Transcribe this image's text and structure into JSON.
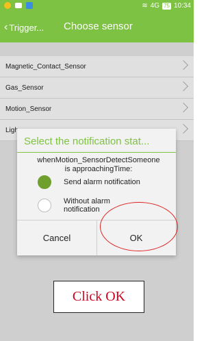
{
  "status_bar": {
    "carrier_icons": [
      "app-icon",
      "message-icon",
      "ie-icon"
    ],
    "signal_text": "4G",
    "battery": "75",
    "time": "10:34"
  },
  "app_bar": {
    "back_label": "Trigger...",
    "title": "Choose sensor",
    "color": "#7dc242"
  },
  "sensor_list": [
    {
      "label": "Magnetic_Contact_Sensor"
    },
    {
      "label": "Gas_Sensor"
    },
    {
      "label": "Motion_Sensor"
    },
    {
      "label": "Ligh"
    }
  ],
  "dialog": {
    "title": "Select the notification stat...",
    "message": "whenMotion_SensorDetectSomeone is approachingTime:",
    "options": [
      {
        "label": "Send alarm notification",
        "selected": true
      },
      {
        "label": "Without alarm notification",
        "selected": false
      }
    ],
    "cancel_label": "Cancel",
    "ok_label": "OK"
  },
  "annotation": {
    "callout_text": "Click OK",
    "color": "#d0001e"
  }
}
